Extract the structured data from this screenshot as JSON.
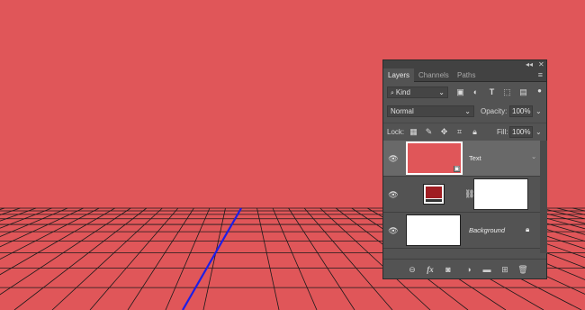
{
  "panel": {
    "collapse_label": "◂◂",
    "close_label": "✕",
    "tabs": [
      {
        "label": "Layers"
      },
      {
        "label": "Channels"
      },
      {
        "label": "Paths"
      }
    ],
    "menu_label": "≡",
    "filter": {
      "label": "Kind"
    },
    "blend_mode": {
      "value": "Normal"
    },
    "opacity": {
      "label": "Opacity:",
      "value": "100%"
    },
    "lock": {
      "label": "Lock:"
    },
    "fill": {
      "label": "Fill:",
      "value": "100%"
    },
    "layers": [
      {
        "name": "Text",
        "thumb_color": "#e05659",
        "selected": true
      },
      {
        "name": "",
        "adjust_color": "#a01e23",
        "mask": "white",
        "selected": false
      },
      {
        "name": "Background",
        "thumb_color": "#ffffff",
        "locked": true,
        "selected": false
      }
    ]
  },
  "canvas": {
    "background_color": "#e05659",
    "grid_color": "#1a1a1a",
    "guide_color": "#1e1ee6"
  }
}
